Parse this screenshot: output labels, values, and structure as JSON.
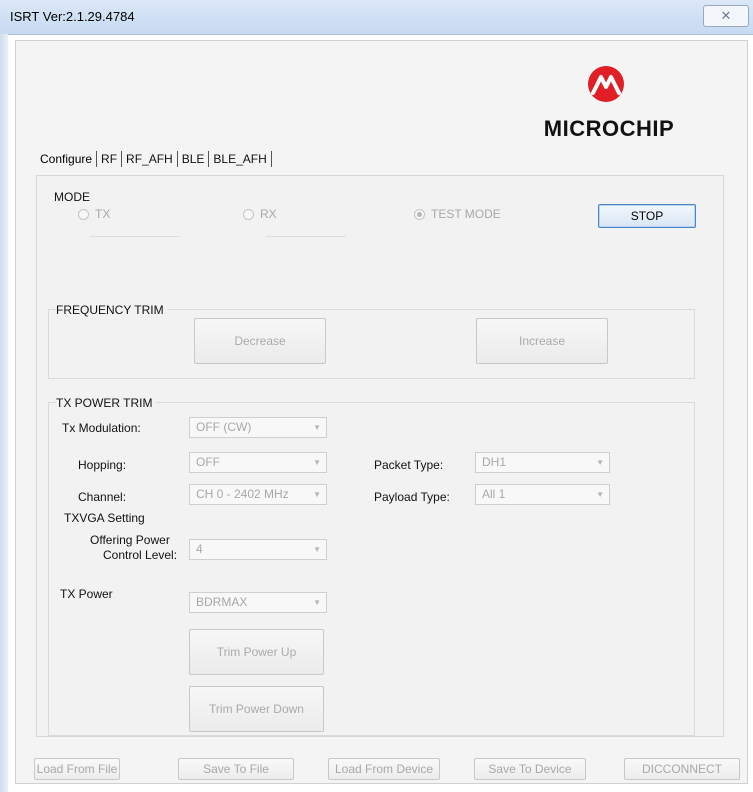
{
  "window": {
    "title": "ISRT Ver:2.1.29.4784",
    "close_label": "✕"
  },
  "logo": {
    "brand": "MICROCHIP",
    "color": "#e11f26"
  },
  "tabs": [
    "Configure",
    "RF",
    "RF_AFH",
    "BLE",
    "BLE_AFH"
  ],
  "mode": {
    "label": "MODE",
    "options": [
      {
        "label": "TX",
        "selected": false
      },
      {
        "label": "RX",
        "selected": false
      },
      {
        "label": "TEST MODE",
        "selected": true
      }
    ],
    "stop_label": "STOP"
  },
  "frequency_trim": {
    "label": "FREQUENCY TRIM",
    "decrease": "Decrease",
    "increase": "Increase"
  },
  "tx_power_trim": {
    "label": "TX POWER TRIM",
    "tx_modulation": {
      "label": "Tx Modulation:",
      "value": "OFF (CW)"
    },
    "hopping": {
      "label": "Hopping:",
      "value": "OFF"
    },
    "channel": {
      "label": "Channel:",
      "value": "CH 0 - 2402 MHz"
    },
    "packet_type": {
      "label": "Packet Type:",
      "value": "DH1"
    },
    "payload_type": {
      "label": "Payload Type:",
      "value": "All 1"
    },
    "txvga": {
      "label": "TXVGA Setting",
      "offering_label_1": "Offering Power",
      "offering_label_2": "Control Level:",
      "value": "4"
    },
    "tx_power": {
      "label": "TX Power",
      "value": "BDRMAX"
    },
    "trim_up": "Trim Power Up",
    "trim_down": "Trim Power Down"
  },
  "footer": {
    "load_file": "Load From File",
    "save_file": "Save To File",
    "load_device": "Load From Device",
    "save_device": "Save To Device",
    "disconnect": "DICCONNECT"
  }
}
